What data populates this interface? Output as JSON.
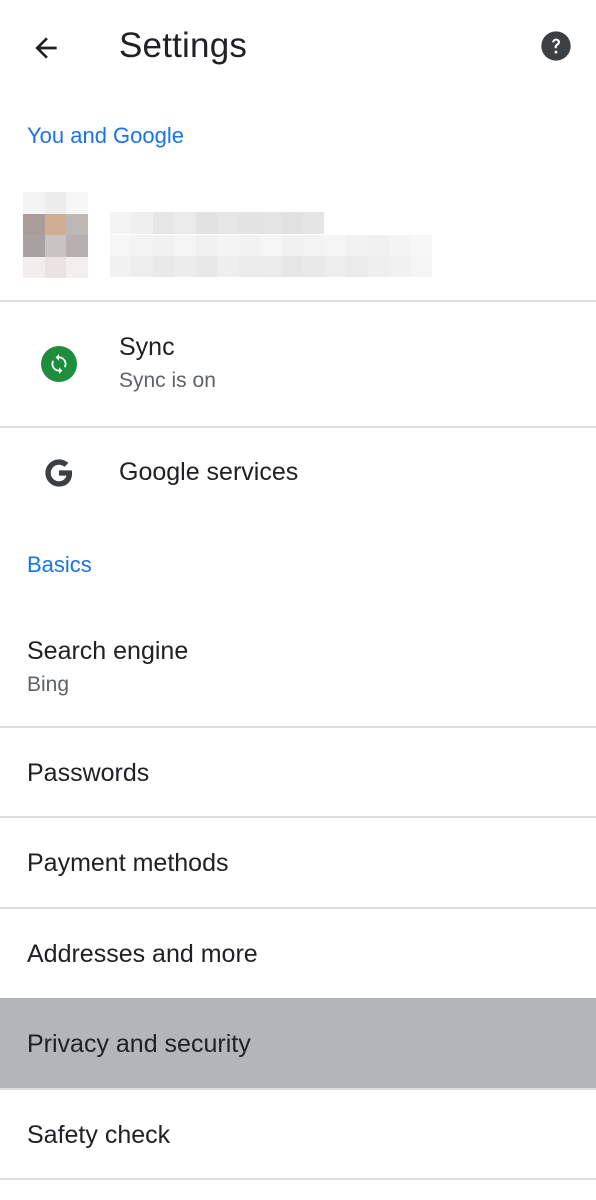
{
  "appbar": {
    "back_icon": "arrow-back-icon",
    "title": "Settings",
    "help_icon": "help-circle-icon"
  },
  "sections": {
    "you_and_google": "You and Google",
    "basics": "Basics"
  },
  "account": {
    "profile_state": "blurred"
  },
  "sync": {
    "title": "Sync",
    "subtitle": "Sync is on",
    "icon": "sync-icon",
    "icon_color": "#1e8e3e"
  },
  "google_services": {
    "title": "Google services",
    "icon": "google-g-icon"
  },
  "basics": {
    "search_engine": {
      "title": "Search engine",
      "subtitle": "Bing"
    },
    "passwords": "Passwords",
    "payment_methods": "Payment methods",
    "addresses": "Addresses and more",
    "privacy": "Privacy and security",
    "safety_check": "Safety check"
  },
  "colors": {
    "accent": "#1a73e8",
    "text_primary": "#202124",
    "text_secondary": "#5f6368",
    "divider": "#dadce0",
    "pressed_row": "#b4b5b6"
  }
}
